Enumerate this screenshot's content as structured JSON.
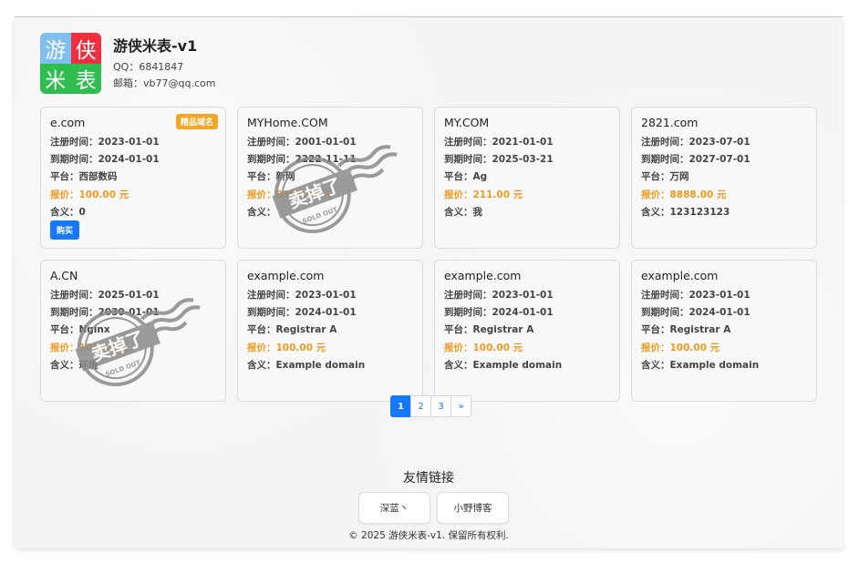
{
  "site": {
    "logo_chars": [
      "游",
      "侠",
      "米",
      "表"
    ],
    "title": "游侠米表-v1",
    "qq": "QQ：6841847",
    "email": "邮箱：vb77@qq.com"
  },
  "labels": {
    "reg": "注册时间：",
    "exp": "到期时间：",
    "platform": "平台：",
    "price": "报价：",
    "meaning": "含义："
  },
  "domains": [
    {
      "name": "e.com",
      "reg": "2023-01-01",
      "exp": "2024-01-01",
      "platform": "西部数码",
      "price": "100.00 元",
      "meaning": "0",
      "badge": "精品域名",
      "buy": "购买",
      "sold": false
    },
    {
      "name": "MYHome.COM",
      "reg": "2001-01-01",
      "exp": "2222-11-11",
      "platform": "新网",
      "price": "8888.00 元",
      "meaning": "",
      "sold": true
    },
    {
      "name": "MY.COM",
      "reg": "2021-01-01",
      "exp": "2025-03-21",
      "platform": "Ag",
      "price": "211.00 元",
      "meaning": "我",
      "sold": false
    },
    {
      "name": "2821.com",
      "reg": "2023-07-01",
      "exp": "2027-07-01",
      "platform": "万网",
      "price": "8888.00 元",
      "meaning": "123123123",
      "sold": false
    },
    {
      "name": "A.CN",
      "reg": "2025-01-01",
      "exp": "2030-01-01",
      "platform": "Nginx",
      "price": "100.00 元",
      "meaning": "环境",
      "sold": true
    },
    {
      "name": "example.com",
      "reg": "2023-01-01",
      "exp": "2024-01-01",
      "platform": "Registrar A",
      "price": "100.00 元",
      "meaning": "Example domain",
      "sold": false
    },
    {
      "name": "example.com",
      "reg": "2023-01-01",
      "exp": "2024-01-01",
      "platform": "Registrar A",
      "price": "100.00 元",
      "meaning": "Example domain",
      "sold": false
    },
    {
      "name": "example.com",
      "reg": "2023-01-01",
      "exp": "2024-01-01",
      "platform": "Registrar A",
      "price": "100.00 元",
      "meaning": "Example domain",
      "sold": false
    }
  ],
  "stamp": {
    "main": "卖掉了",
    "sub": "SOLD OUT"
  },
  "pagination": {
    "pages": [
      "1",
      "2",
      "3"
    ],
    "next": "»",
    "current": "1"
  },
  "footer": {
    "links_title": "友情链接",
    "links": [
      "深蓝丶",
      "小野博客"
    ],
    "copyright": "© 2025 游侠米表-v1. 保留所有权利."
  },
  "colors": {
    "accent": "#1677ff",
    "price": "#f39a1e",
    "badge": "#f5a623",
    "stamp": "#8a8a8a"
  }
}
